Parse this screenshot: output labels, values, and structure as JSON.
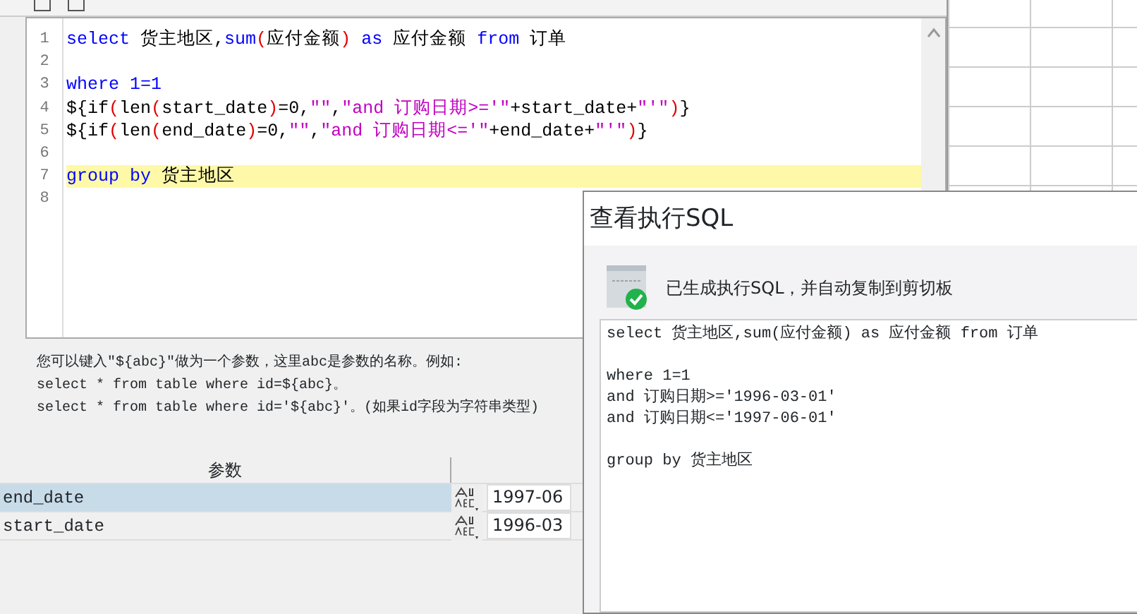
{
  "code_editor": {
    "lines": [
      {
        "number": "1",
        "highlighted": false,
        "tokens": [
          {
            "text": "select",
            "kind": "keyword"
          },
          {
            "text": " 货主地区,",
            "kind": "plain"
          },
          {
            "text": "sum",
            "kind": "keyword"
          },
          {
            "text": "(",
            "kind": "paren"
          },
          {
            "text": "应付金额",
            "kind": "plain"
          },
          {
            "text": ")",
            "kind": "paren"
          },
          {
            "text": " as ",
            "kind": "keyword"
          },
          {
            "text": "应付金额 ",
            "kind": "plain"
          },
          {
            "text": "from",
            "kind": "keyword"
          },
          {
            "text": " 订单",
            "kind": "plain"
          }
        ]
      },
      {
        "number": "2",
        "highlighted": false
      },
      {
        "number": "3",
        "highlighted": false,
        "tokens": [
          {
            "text": "where 1=1",
            "kind": "keyword"
          }
        ]
      },
      {
        "number": "4",
        "highlighted": false,
        "tokens": [
          {
            "text": "${if",
            "kind": "plain"
          },
          {
            "text": "(",
            "kind": "paren"
          },
          {
            "text": "len",
            "kind": "plain"
          },
          {
            "text": "(",
            "kind": "paren"
          },
          {
            "text": "start_date",
            "kind": "plain"
          },
          {
            "text": ")",
            "kind": "paren"
          },
          {
            "text": "=0,",
            "kind": "plain"
          },
          {
            "text": "\"\"",
            "kind": "string"
          },
          {
            "text": ",",
            "kind": "plain"
          },
          {
            "text": "\"and 订购日期>='\"",
            "kind": "string"
          },
          {
            "text": "+start_date+",
            "kind": "plain"
          },
          {
            "text": "\"'\"",
            "kind": "string"
          },
          {
            "text": ")",
            "kind": "paren"
          },
          {
            "text": "}",
            "kind": "plain"
          }
        ]
      },
      {
        "number": "5",
        "highlighted": false,
        "tokens": [
          {
            "text": "${if",
            "kind": "plain"
          },
          {
            "text": "(",
            "kind": "paren"
          },
          {
            "text": "len",
            "kind": "plain"
          },
          {
            "text": "(",
            "kind": "paren"
          },
          {
            "text": "end_date",
            "kind": "plain"
          },
          {
            "text": ")",
            "kind": "paren"
          },
          {
            "text": "=0,",
            "kind": "plain"
          },
          {
            "text": "\"\"",
            "kind": "string"
          },
          {
            "text": ",",
            "kind": "plain"
          },
          {
            "text": "\"and 订购日期<='\"",
            "kind": "string"
          },
          {
            "text": "+end_date+",
            "kind": "plain"
          },
          {
            "text": "\"'\"",
            "kind": "string"
          },
          {
            "text": ")",
            "kind": "paren"
          },
          {
            "text": "}",
            "kind": "plain"
          }
        ]
      },
      {
        "number": "6",
        "highlighted": false
      },
      {
        "number": "7",
        "highlighted": true,
        "tokens": [
          {
            "text": "group by",
            "kind": "keyword"
          },
          {
            "text": " 货主地区",
            "kind": "plain"
          }
        ]
      },
      {
        "number": "8",
        "highlighted": false
      }
    ]
  },
  "hint": {
    "lines": [
      "您可以键入\"${abc}\"做为一个参数，这里abc是参数的名称。例如:",
      "select * from table where id=${abc}。",
      "select * from table where id='${abc}'。(如果id字段为字符串类型)"
    ]
  },
  "parameters": {
    "columns": [
      "参数"
    ],
    "rows": [
      {
        "name": "end_date",
        "value": "1997-06",
        "selected": true
      },
      {
        "name": "start_date",
        "value": "1996-03",
        "selected": false
      }
    ]
  },
  "dialog": {
    "title": "查看执行SQL",
    "message": "已生成执行SQL，并自动复制到剪切板",
    "sql_blocks": [
      [
        "select 货主地区,sum(应付金额) as 应付金额 from 订单"
      ],
      [
        "where 1=1",
        "and 订购日期>='1996-03-01'",
        "and 订购日期<='1997-06-01'"
      ],
      [
        "group by 货主地区"
      ]
    ]
  }
}
